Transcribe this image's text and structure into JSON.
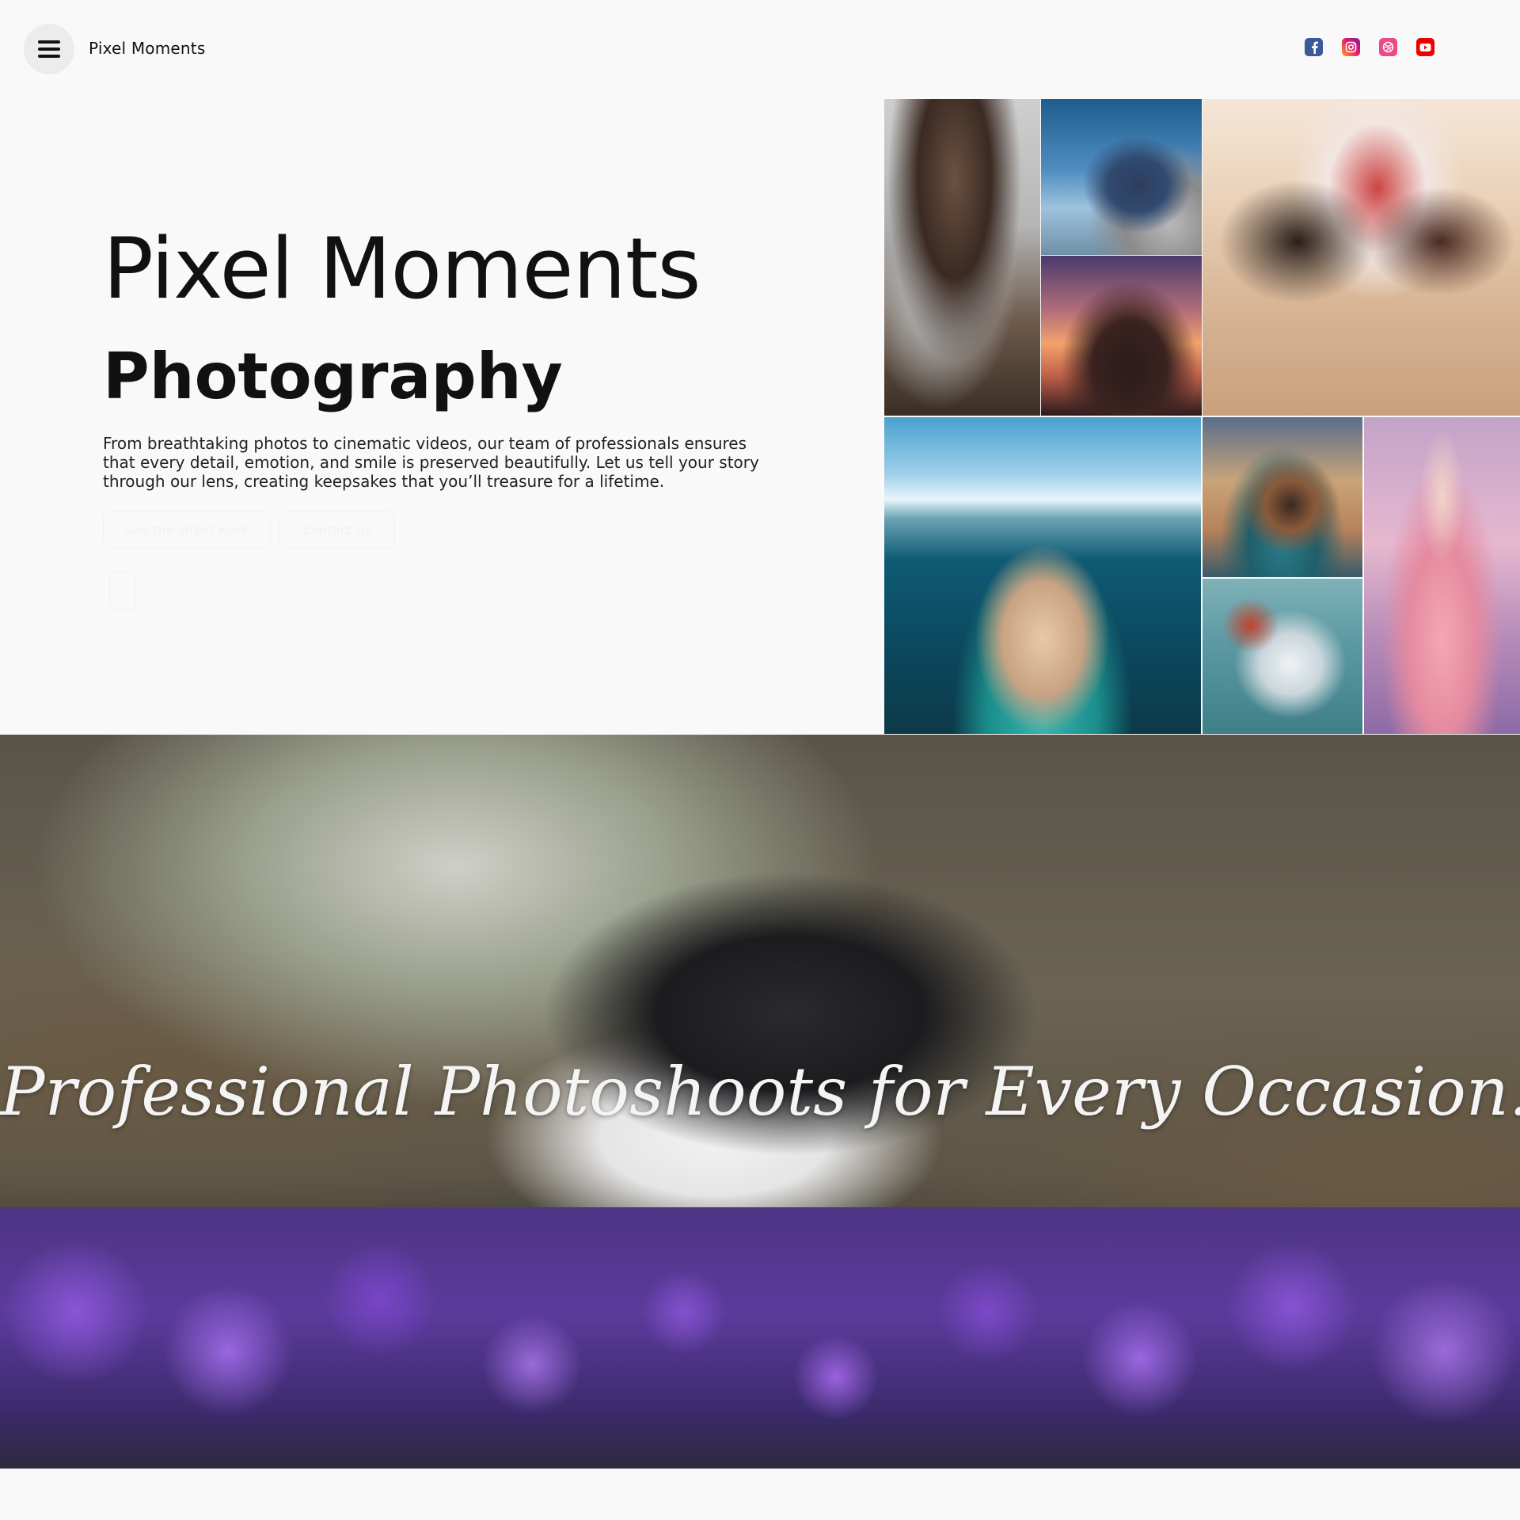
{
  "header": {
    "brand": "Pixel Moments",
    "menu_icon": "hamburger-menu-icon",
    "socials": [
      {
        "name": "facebook",
        "icon": "facebook-icon",
        "color": "#3b5998"
      },
      {
        "name": "instagram",
        "icon": "instagram-icon",
        "color": "#e91e63"
      },
      {
        "name": "dribbble",
        "icon": "dribbble-icon",
        "color": "#ea4c89"
      },
      {
        "name": "youtube",
        "icon": "youtube-icon",
        "color": "#ee0000"
      }
    ]
  },
  "hero": {
    "title": "Pixel Moments",
    "subtitle": "Photography",
    "description": "From breathtaking photos to cinematic videos, our team of professionals ensures that every detail, emotion, and smile is preserved beautifully. Let us tell your story through our lens, creating keepsakes that you’ll treasure for a lifetime.",
    "buttons": {
      "latest": "See the latest work",
      "contact": "Contact Us"
    }
  },
  "banner": {
    "headline": "Professional Photoshoots for Every Occasion."
  }
}
